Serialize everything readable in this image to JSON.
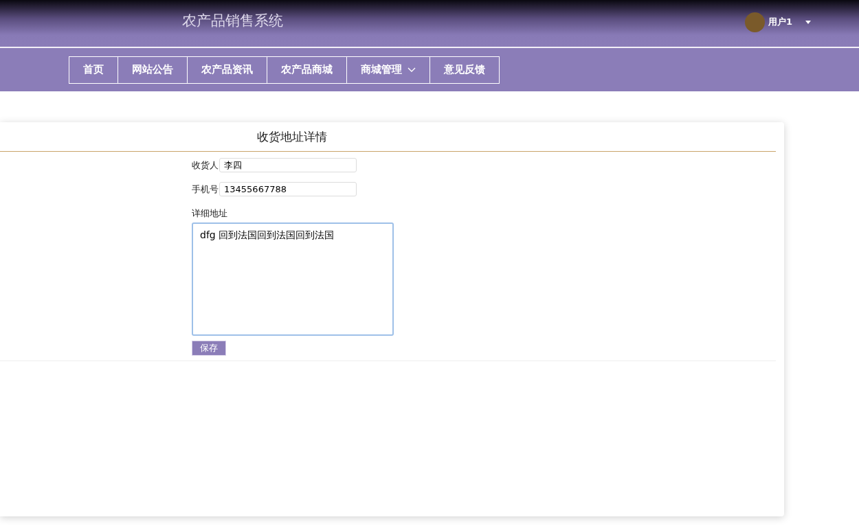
{
  "header": {
    "site_title": "农产品销售系统",
    "user": "用户1"
  },
  "nav": [
    {
      "label": "首页",
      "has_menu": false
    },
    {
      "label": "网站公告",
      "has_menu": false
    },
    {
      "label": "农产品资讯",
      "has_menu": false
    },
    {
      "label": "农产品商城",
      "has_menu": false
    },
    {
      "label": "商城管理",
      "has_menu": true
    },
    {
      "label": "意见反馈",
      "has_menu": false
    }
  ],
  "card": {
    "title": "收货地址详情",
    "fields": [
      {
        "label": "收货人",
        "value": "李四"
      },
      {
        "label": "手机号",
        "value": "13455667788"
      }
    ],
    "address": {
      "label": "详细地址",
      "value": "dfg 回到法国回到法国回到法国"
    },
    "save_button": "保存"
  }
}
